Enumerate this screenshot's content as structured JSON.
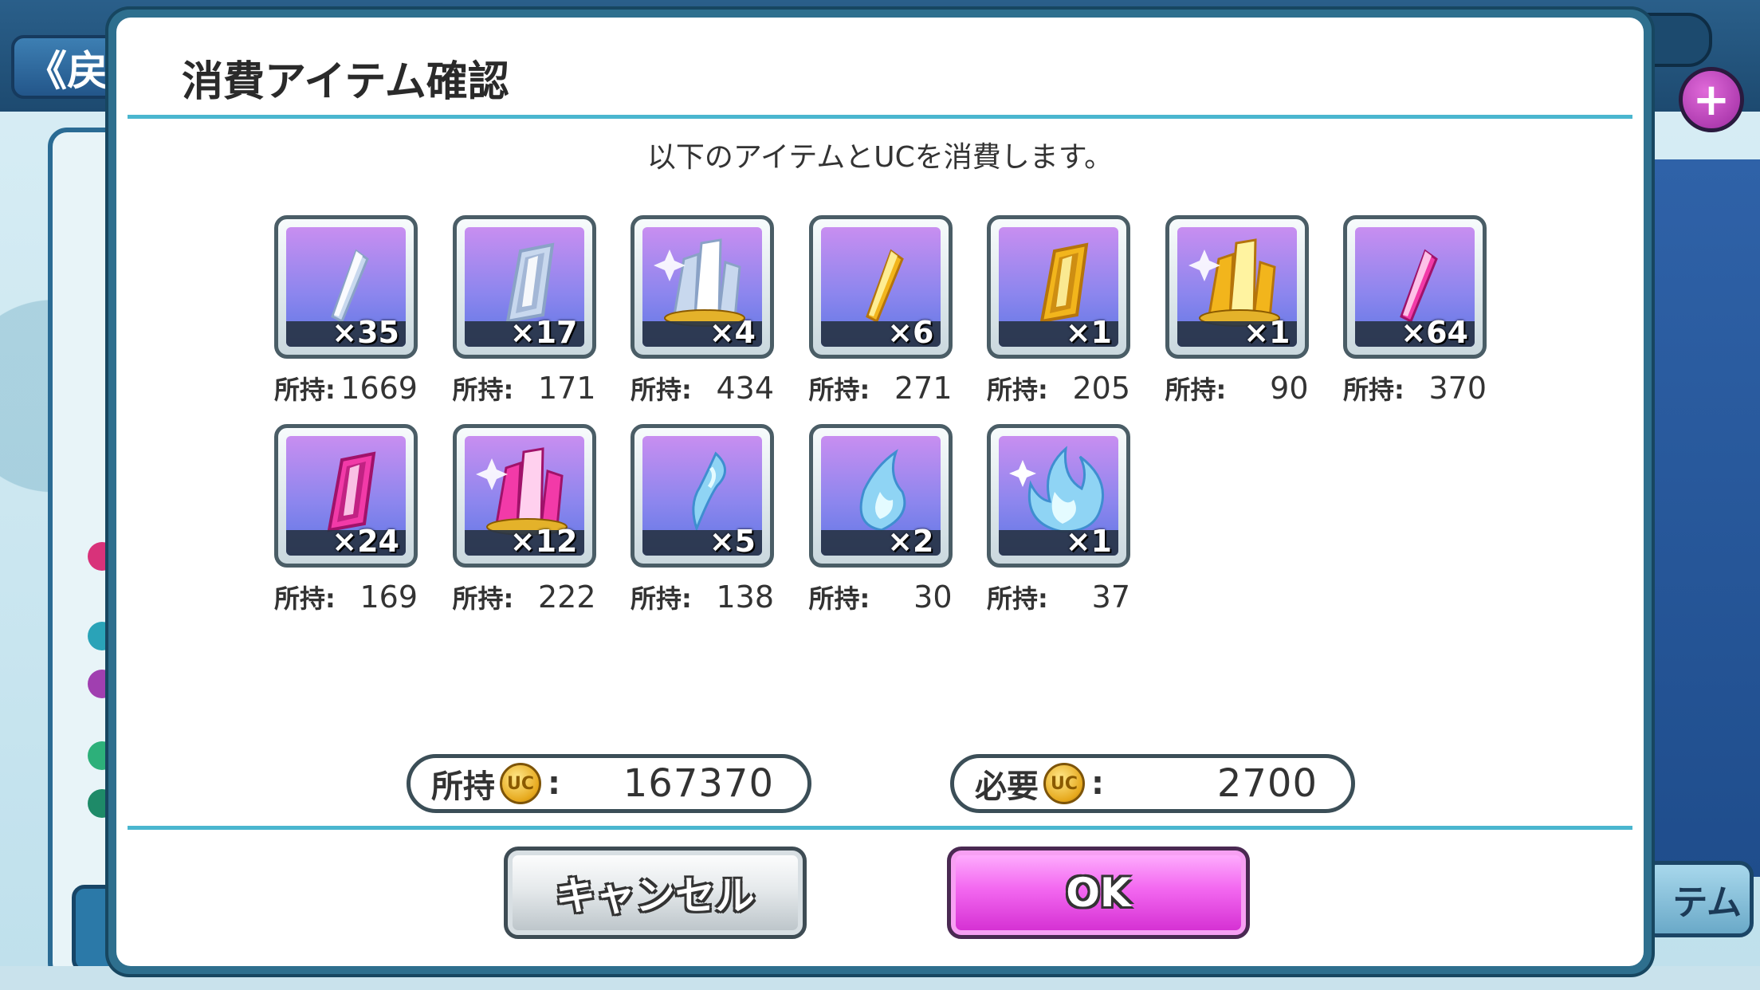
{
  "background": {
    "back_label": "《戻",
    "right_button_label": "テム",
    "plus_label": "+"
  },
  "dialog": {
    "title": "消費アイテム確認",
    "message": "以下のアイテムとUCを消費します。",
    "items": [
      {
        "icon": "white-shard-icon",
        "count": "×35",
        "owned_label": "所持:",
        "owned": "1669"
      },
      {
        "icon": "white-crystal-icon",
        "count": "×17",
        "owned_label": "所持:",
        "owned": "171"
      },
      {
        "icon": "white-cluster-icon",
        "count": "×4",
        "owned_label": "所持:",
        "owned": "434"
      },
      {
        "icon": "gold-shard-icon",
        "count": "×6",
        "owned_label": "所持:",
        "owned": "271"
      },
      {
        "icon": "gold-crystal-icon",
        "count": "×1",
        "owned_label": "所持:",
        "owned": "205"
      },
      {
        "icon": "gold-cluster-icon",
        "count": "×1",
        "owned_label": "所持:",
        "owned": "90"
      },
      {
        "icon": "pink-shard-icon",
        "count": "×64",
        "owned_label": "所持:",
        "owned": "370"
      },
      {
        "icon": "pink-crystal-icon",
        "count": "×24",
        "owned_label": "所持:",
        "owned": "169"
      },
      {
        "icon": "pink-cluster-icon",
        "count": "×12",
        "owned_label": "所持:",
        "owned": "222"
      },
      {
        "icon": "blue-drop-icon",
        "count": "×5",
        "owned_label": "所持:",
        "owned": "138"
      },
      {
        "icon": "blue-flame-icon",
        "count": "×2",
        "owned_label": "所持:",
        "owned": "30"
      },
      {
        "icon": "blue-big-flame-icon",
        "count": "×1",
        "owned_label": "所持:",
        "owned": "37"
      }
    ],
    "currency": {
      "owned_label": "所持",
      "owned_value": "167370",
      "required_label": "必要",
      "required_value": "2700",
      "coin_label": "UC",
      "separator": ":"
    },
    "buttons": {
      "cancel": "キャンセル",
      "ok": "OK"
    }
  },
  "colors": {
    "accent_rule": "#4ab6cf",
    "ok_button": "#e94be6",
    "cancel_button": "#d9dfe2",
    "item_bg_top": "#c88ef0",
    "item_bg_bottom": "#5f77e4"
  }
}
